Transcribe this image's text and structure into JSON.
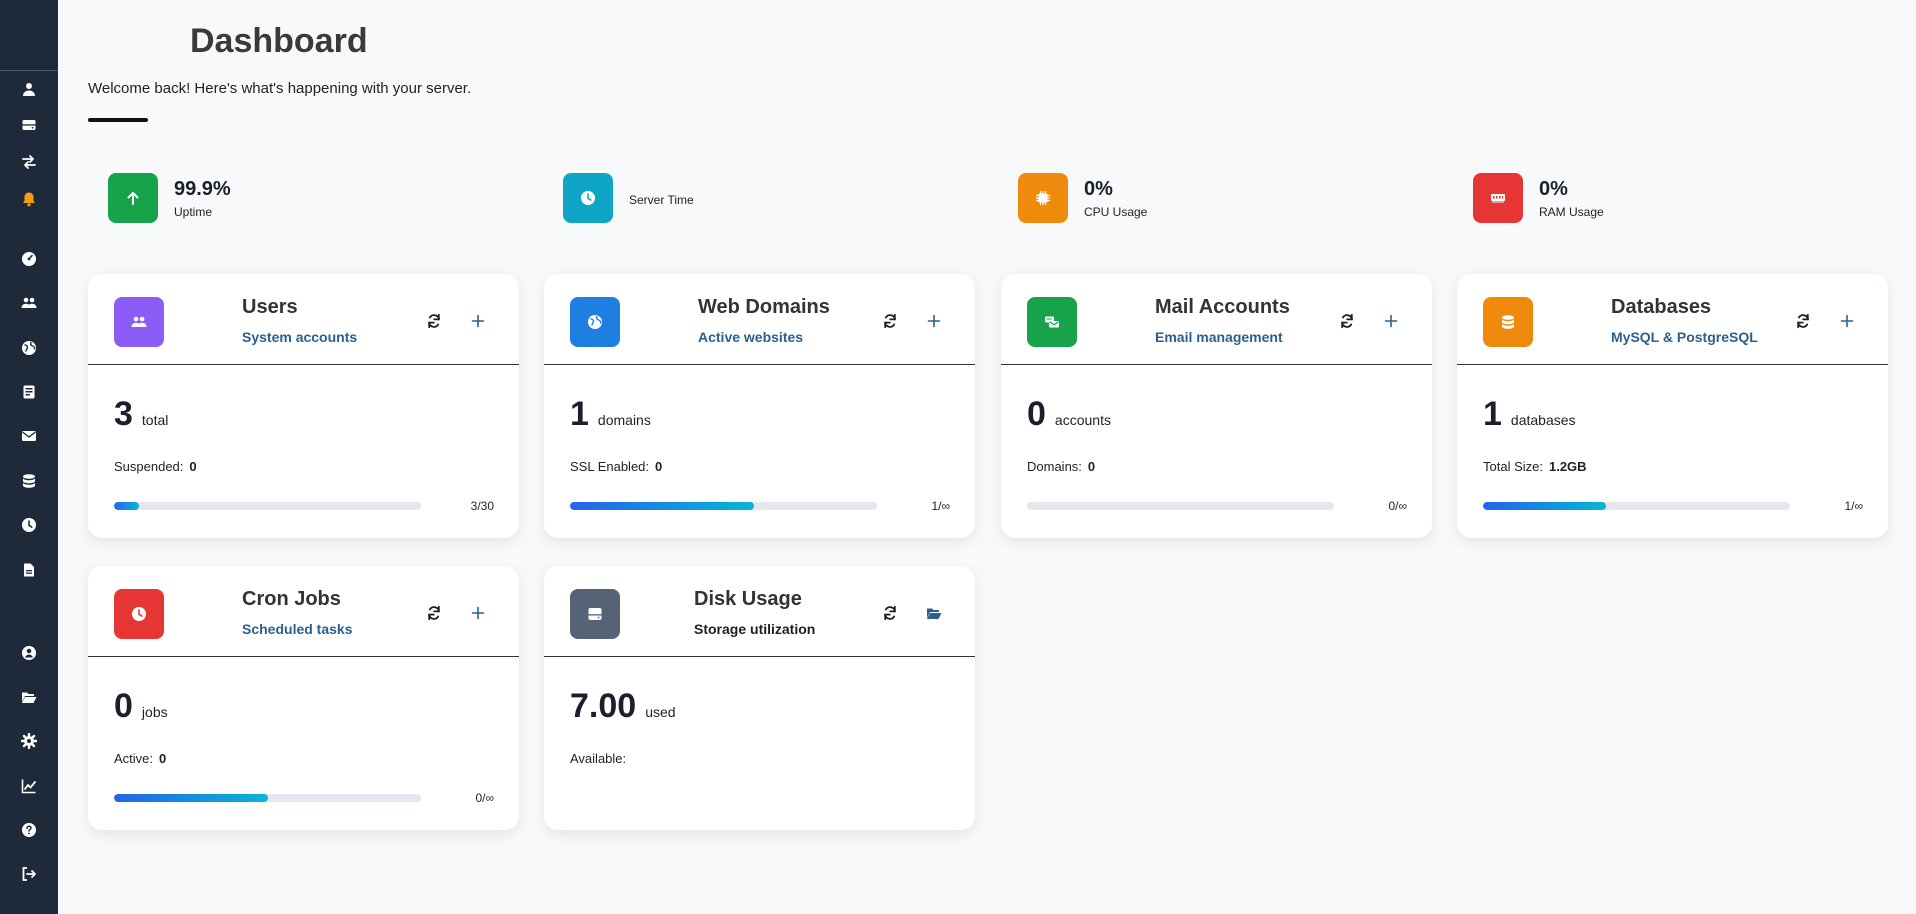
{
  "header": {
    "title": "Dashboard",
    "subtitle": "Welcome back! Here's what's happening with your server."
  },
  "sidebar": {
    "icons_top": [
      "user-icon",
      "server-icon",
      "transfer-icon",
      "bell-icon",
      "dashboard-icon",
      "users-icon",
      "globe-icon",
      "address-book-icon",
      "mail-icon",
      "database-icon",
      "clock-icon",
      "file-icon"
    ],
    "icons_bottom": [
      "account-icon",
      "folder-open-icon",
      "settings-icon",
      "chart-icon",
      "help-icon",
      "logout-icon"
    ],
    "bell_color": "#f59e0b"
  },
  "stats": [
    {
      "value": "99.9%",
      "label": "Uptime",
      "icon": "arrow-up-icon",
      "color": "#16a34a"
    },
    {
      "value": "",
      "label": "Server Time",
      "icon": "clock-icon",
      "color": "#0ea5c6"
    },
    {
      "value": "0%",
      "label": "CPU Usage",
      "icon": "cpu-icon",
      "color": "#f08a0c"
    },
    {
      "value": "0%",
      "label": "RAM Usage",
      "icon": "memory-icon",
      "color": "#e53535"
    }
  ],
  "cards": [
    {
      "title": "Users",
      "subtitle": "System accounts",
      "icon": "users-icon",
      "color": "#8b5cf6",
      "value": "3",
      "unit": "total",
      "detail_label": "Suspended:",
      "detail_value": "0",
      "progress": 0.083,
      "count": "3/30",
      "action2": "add-icon"
    },
    {
      "title": "Web Domains",
      "subtitle": "Active websites",
      "icon": "globe-icon",
      "color": "#1f7fe0",
      "value": "1",
      "unit": "domains",
      "detail_label": "SSL Enabled:",
      "detail_value": "0",
      "progress": 0.6,
      "count": "1/∞",
      "action2": "add-icon"
    },
    {
      "title": "Mail Accounts",
      "subtitle": "Email management",
      "icon": "mail-accounts-icon",
      "color": "#16a34a",
      "value": "0",
      "unit": "accounts",
      "detail_label": "Domains:",
      "detail_value": "0",
      "progress": 0,
      "count": "0/∞",
      "action2": "add-icon"
    },
    {
      "title": "Databases",
      "subtitle": "MySQL & PostgreSQL",
      "icon": "database-icon",
      "color": "#f08a0c",
      "value": "1",
      "unit": "databases",
      "detail_label": "Total Size:",
      "detail_value": "1.2GB",
      "progress": 0.4,
      "count": "1/∞",
      "action2": "add-icon"
    },
    {
      "title": "Cron Jobs",
      "subtitle": "Scheduled tasks",
      "icon": "clock-icon",
      "color": "#e53535",
      "value": "0",
      "unit": "jobs",
      "detail_label": "Active:",
      "detail_value": "0",
      "progress": 0.5,
      "count": "0/∞",
      "action2": "add-icon"
    },
    {
      "title": "Disk Usage",
      "subtitle": "Storage utilization",
      "icon": "disk-icon",
      "color": "#566275",
      "value": "7.00",
      "unit": "used",
      "detail_label": "Available:",
      "detail_value": "",
      "progress": null,
      "count": "",
      "action2": "folder-open-icon"
    }
  ]
}
